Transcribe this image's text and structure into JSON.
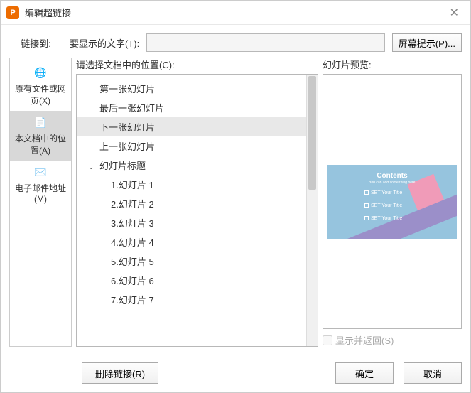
{
  "title": "编辑超链接",
  "top": {
    "link_to_label": "链接到:",
    "display_label": "要显示的文字(T):",
    "display_value": "",
    "screen_tip": "屏幕提示(P)..."
  },
  "sidebar": {
    "items": [
      {
        "label": "原有文件或网页(X)",
        "icon": "🌐",
        "selected": false
      },
      {
        "label": "本文档中的位置(A)",
        "icon": "📄",
        "selected": true
      },
      {
        "label": "电子邮件地址(M)",
        "icon": "✉️",
        "selected": false
      }
    ]
  },
  "tree": {
    "label": "请选择文档中的位置(C):",
    "items": [
      {
        "label": "第一张幻灯片",
        "depth": 0,
        "selected": false
      },
      {
        "label": "最后一张幻灯片",
        "depth": 0,
        "selected": false
      },
      {
        "label": "下一张幻灯片",
        "depth": 0,
        "selected": true
      },
      {
        "label": "上一张幻灯片",
        "depth": 0,
        "selected": false
      },
      {
        "label": "幻灯片标题",
        "depth": 0,
        "selected": false,
        "chevron": true
      },
      {
        "label": "1.幻灯片 1",
        "depth": 1,
        "selected": false
      },
      {
        "label": "2.幻灯片 2",
        "depth": 1,
        "selected": false
      },
      {
        "label": "3.幻灯片 3",
        "depth": 1,
        "selected": false
      },
      {
        "label": "4.幻灯片 4",
        "depth": 1,
        "selected": false
      },
      {
        "label": "5.幻灯片 5",
        "depth": 1,
        "selected": false
      },
      {
        "label": "6.幻灯片 6",
        "depth": 1,
        "selected": false
      },
      {
        "label": "7.幻灯片 7",
        "depth": 1,
        "selected": false
      }
    ]
  },
  "preview": {
    "label": "幻灯片预览:",
    "slide_title": "Contents",
    "slide_sub": "You can add some thing here",
    "slide_items": [
      "SET Your Title",
      "SET Your Title",
      "SET Your Title"
    ],
    "return_label": "显示并返回(S)"
  },
  "buttons": {
    "remove": "删除链接(R)",
    "ok": "确定",
    "cancel": "取消"
  }
}
